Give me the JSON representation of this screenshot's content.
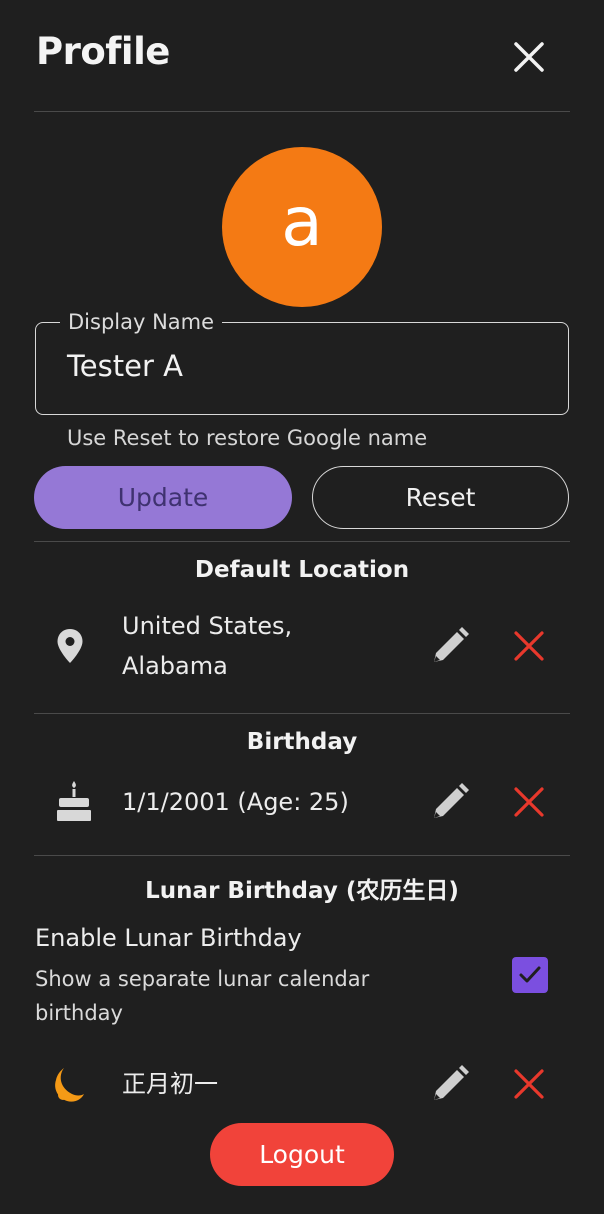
{
  "header": {
    "title": "Profile"
  },
  "avatar": {
    "letter": "a",
    "color": "#f47a14"
  },
  "display_name": {
    "label": "Display Name",
    "value": "Tester A",
    "hint": "Use Reset to restore Google name"
  },
  "buttons": {
    "update_label": "Update",
    "reset_label": "Reset",
    "logout_label": "Logout"
  },
  "default_location": {
    "title": "Default Location",
    "line1": "United States,",
    "line2": "Alabama",
    "icon": "location-pin-icon"
  },
  "birthday": {
    "title": "Birthday",
    "value": "1/1/2001 (Age: 25)",
    "icon": "cake-icon"
  },
  "lunar_birthday": {
    "title": "Lunar Birthday (农历生日)",
    "enable_label": "Enable Lunar Birthday",
    "enable_description": "Show a separate lunar calendar birthday",
    "enabled": true,
    "value": "正月初一",
    "icon": "moon-icon"
  },
  "colors": {
    "accent": "#7b4fe0",
    "update_button": "#9578d6",
    "delete": "#e8382c",
    "logout": "#f1433a",
    "background": "#1f1f1f"
  }
}
